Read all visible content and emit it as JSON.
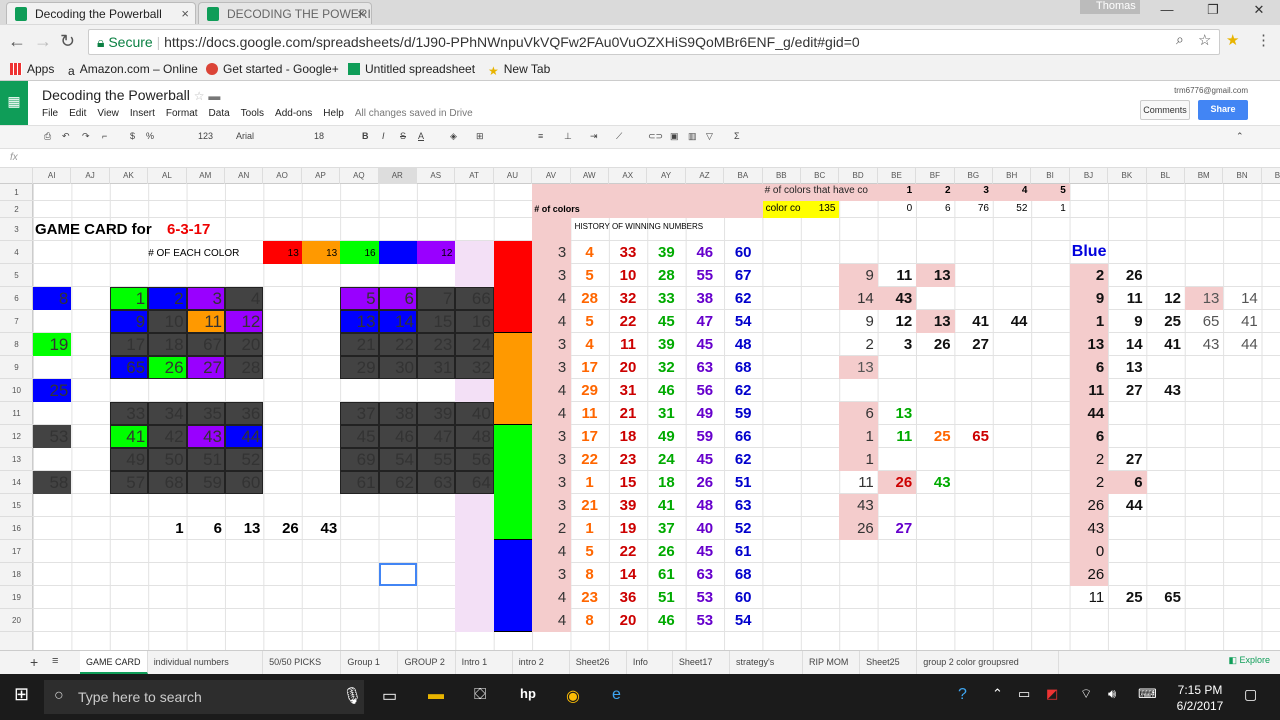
{
  "browser": {
    "tabs": [
      {
        "title": "Decoding the Powerball"
      },
      {
        "title": "DECODING THE POWERI"
      }
    ],
    "user": "Thomas",
    "secure_label": "Secure",
    "url": "https://docs.google.com/spreadsheets/d/1J90-PPhNWnpuVkVQFw2FAu0VuOZXHiS9QoMBr6ENF_g/edit#gid=0",
    "bookmarks": [
      "Apps",
      "Amazon.com – Online",
      "Get started - Google+",
      "Untitled spreadsheet",
      "New Tab"
    ]
  },
  "sheets": {
    "title": "Decoding the Powerball",
    "menus": [
      "File",
      "Edit",
      "View",
      "Insert",
      "Format",
      "Data",
      "Tools",
      "Add-ons",
      "Help"
    ],
    "saved_status": "All changes saved in Drive",
    "account": "trm6776@gmail.com",
    "comments_label": "Comments",
    "share_label": "Share",
    "toolbar": {
      "zoom_pct": "%",
      ".0": ".0",
      ".00": ".00",
      "fmt": "123",
      "font": "Arial",
      "size": "18"
    },
    "fx": "fx",
    "columns": [
      "AI",
      "AJ",
      "AK",
      "AL",
      "AM",
      "AN",
      "AO",
      "AP",
      "AQ",
      "AR",
      "AS",
      "AT",
      "AU",
      "AV",
      "AW",
      "AX",
      "AY",
      "AZ",
      "BA",
      "BB",
      "BC",
      "BD",
      "BE",
      "BF",
      "BG",
      "BH",
      "BI",
      "BJ",
      "BK",
      "BL",
      "BM",
      "BN",
      "BO"
    ],
    "rows": [
      "1",
      "2",
      "3",
      "4",
      "5",
      "6",
      "7",
      "8",
      "9",
      "10",
      "11",
      "12",
      "13",
      "14",
      "15",
      "16",
      "17",
      "18",
      "19",
      "20"
    ],
    "cells": {
      "colors_label": "# of colors that have co",
      "colors_counts": [
        "1",
        "2",
        "3",
        "4",
        "5"
      ],
      "of_colors": "# of colors",
      "color_co": "color co",
      "color_co_val": "135",
      "row2_vals": [
        "0",
        "6",
        "76",
        "52",
        "1"
      ],
      "game_card": "GAME CARD for ",
      "game_date": "6-3-17",
      "each_color": "# OF EACH COLOR",
      "color_counts": [
        "13",
        "13",
        "16",
        "",
        ""
      ],
      "color_counts_tail": "12",
      "history": "HISTORY OF WINNING NUMBERS",
      "blue": "Blue",
      "picks": [
        "1",
        "6",
        "13",
        "26",
        "43"
      ]
    },
    "game_grid": [
      [
        "1",
        "2",
        "3",
        "4",
        "",
        "5",
        "6",
        "7",
        "66"
      ],
      [
        "9",
        "10",
        "11",
        "12",
        "",
        "13",
        "14",
        "15",
        "16"
      ],
      [
        "17",
        "18",
        "67",
        "20",
        "",
        "21",
        "22",
        "23",
        "24"
      ],
      [
        "65",
        "26",
        "27",
        "28",
        "",
        "29",
        "30",
        "31",
        "32"
      ],
      [
        "",
        "",
        "",
        "",
        "",
        "",
        "",
        "",
        ""
      ],
      [
        "33",
        "34",
        "35",
        "36",
        "",
        "37",
        "38",
        "39",
        "40"
      ],
      [
        "41",
        "42",
        "43",
        "44",
        "",
        "45",
        "46",
        "47",
        "48"
      ],
      [
        "49",
        "50",
        "51",
        "52",
        "",
        "69",
        "54",
        "55",
        "56"
      ],
      [
        "57",
        "68",
        "59",
        "60",
        "",
        "61",
        "62",
        "63",
        "64"
      ]
    ],
    "left_col": [
      "8",
      "",
      "19",
      "",
      "25",
      "",
      "53",
      "",
      "58"
    ],
    "history_rows": [
      [
        "3",
        "4",
        "33",
        "39",
        "46",
        "60"
      ],
      [
        "3",
        "5",
        "10",
        "28",
        "55",
        "67"
      ],
      [
        "4",
        "28",
        "32",
        "33",
        "38",
        "62"
      ],
      [
        "4",
        "5",
        "22",
        "45",
        "47",
        "54"
      ],
      [
        "3",
        "4",
        "11",
        "39",
        "45",
        "48"
      ],
      [
        "3",
        "17",
        "20",
        "32",
        "63",
        "68"
      ],
      [
        "4",
        "29",
        "31",
        "46",
        "56",
        "62"
      ],
      [
        "4",
        "11",
        "21",
        "31",
        "49",
        "59"
      ],
      [
        "3",
        "17",
        "18",
        "49",
        "59",
        "66"
      ],
      [
        "3",
        "22",
        "23",
        "24",
        "45",
        "62"
      ],
      [
        "3",
        "1",
        "15",
        "18",
        "26",
        "51"
      ],
      [
        "3",
        "21",
        "39",
        "41",
        "48",
        "63"
      ],
      [
        "2",
        "1",
        "19",
        "37",
        "40",
        "52"
      ],
      [
        "4",
        "5",
        "22",
        "26",
        "45",
        "61"
      ],
      [
        "3",
        "8",
        "14",
        "61",
        "63",
        "68"
      ],
      [
        "4",
        "23",
        "36",
        "51",
        "53",
        "60"
      ],
      [
        "4",
        "8",
        "20",
        "46",
        "53",
        "54"
      ]
    ],
    "bd_col": [
      "",
      "9",
      "14",
      "9",
      "2",
      "13",
      "",
      "6",
      "1",
      "1",
      "11",
      "43",
      "26"
    ],
    "be_col": [
      "",
      "11",
      "43",
      "12",
      "3",
      "",
      "",
      "13",
      "11",
      "",
      "26",
      "",
      "27"
    ],
    "bf_col": [
      "",
      "13",
      "",
      "13",
      "26",
      "",
      "",
      "",
      "25",
      "",
      "43",
      "",
      ""
    ],
    "bg_col": [
      "",
      "",
      "",
      "41",
      "27",
      "",
      "",
      "",
      "65",
      "",
      "",
      "",
      ""
    ],
    "bh_col": [
      "",
      "",
      "",
      "44",
      "",
      "",
      "",
      "",
      "",
      "",
      "",
      "",
      ""
    ],
    "bj_col": [
      "",
      "2",
      "9",
      "1",
      "13",
      "6",
      "11",
      "44",
      "6",
      "2",
      "2",
      "26",
      "43",
      "0",
      "26",
      "11"
    ],
    "bk_col": [
      "",
      "26",
      "11",
      "9",
      "14",
      "13",
      "27",
      "",
      "",
      "27",
      "6",
      "44",
      "",
      "",
      "",
      "25"
    ],
    "bl_col": [
      "",
      "",
      "12",
      "25",
      "41",
      "",
      "43",
      "",
      "",
      "",
      "",
      "",
      "",
      "",
      "",
      "65"
    ],
    "bm_col": [
      "",
      "",
      "13",
      "65",
      "43",
      "",
      "",
      "",
      "",
      "",
      "",
      "",
      "",
      "",
      "",
      ""
    ],
    "bn_col": [
      "",
      "",
      "14",
      "41",
      "44",
      "",
      "",
      "",
      "",
      "",
      "",
      "",
      "",
      "",
      "",
      ""
    ],
    "sheet_tabs": [
      "GAME CARD",
      "individual numbers",
      "50/50 PICKS",
      "Group 1",
      "GROUP 2",
      "Intro 1",
      "intro 2",
      "Sheet26",
      "Info",
      "Sheet17",
      "strategy's",
      "RIP MOM",
      "Sheet25",
      "group 2 color groupsred"
    ],
    "explore": "Explore"
  },
  "taskbar": {
    "search": "Type here to search",
    "time": "7:15 PM",
    "date": "6/2/2017"
  }
}
